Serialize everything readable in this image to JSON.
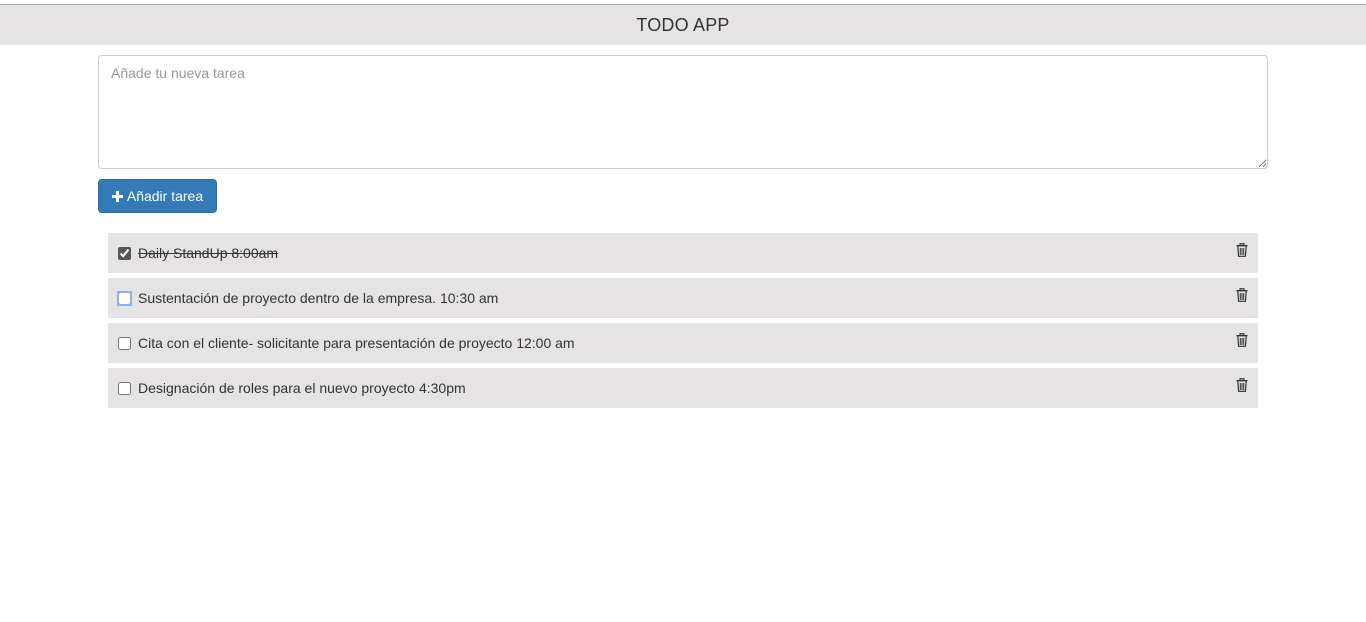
{
  "header": {
    "title": "TODO APP"
  },
  "new_task": {
    "value": "",
    "placeholder": "Añade tu nueva tarea"
  },
  "add_button": {
    "label": "Añadir tarea",
    "icon": "plus-icon",
    "color": "#337ab7"
  },
  "tasks": [
    {
      "text": "Daily StandUp 8:00am",
      "completed": true
    },
    {
      "text": "Sustentación de proyecto dentro de la empresa. 10:30 am",
      "completed": false
    },
    {
      "text": "Cita con el cliente- solicitante para presentación de proyecto 12:00 am",
      "completed": false
    },
    {
      "text": "Designación de roles para el nuevo proyecto 4:30pm",
      "completed": false
    }
  ],
  "task_delete_icon": "trash-icon",
  "colors": {
    "header_background": "#e5e3e4",
    "task_background": "#e5e3e4",
    "primary": "#337ab7"
  }
}
